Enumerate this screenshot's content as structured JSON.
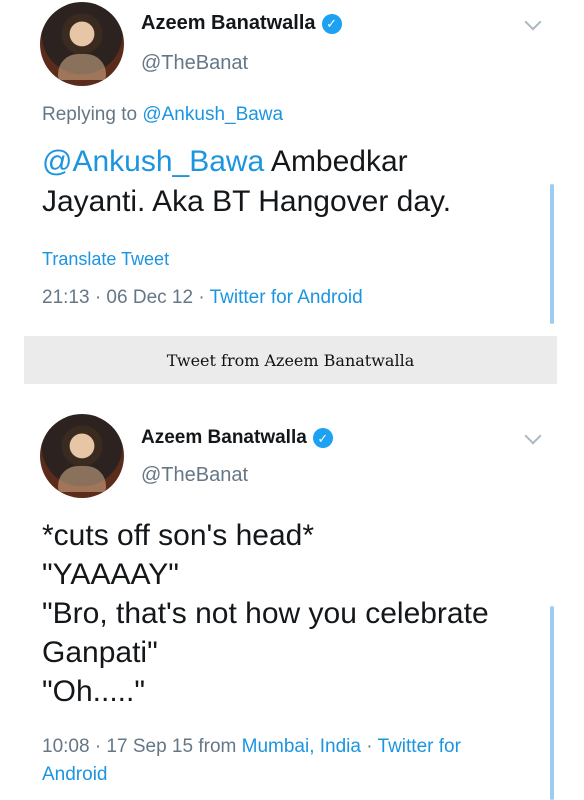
{
  "tweet1": {
    "author_name": "Azeem Banatwalla",
    "verified_glyph": "✓",
    "handle": "@TheBanat",
    "replying_prefix": "Replying to",
    "replying_to": "@Ankush_Bawa",
    "mention": "@Ankush_Bawa",
    "text_line1_rest": " Ambedkar",
    "text_line2": "Jayanti. Aka BT Hangover day.",
    "translate_label": "Translate Tweet",
    "timestamp": "21:13 · 06 Dec 12 · ",
    "source": "Twitter for Android"
  },
  "caption": {
    "text": "Tweet from Azeem Banatwalla"
  },
  "tweet2": {
    "author_name": "Azeem Banatwalla",
    "verified_glyph": "✓",
    "handle": "@TheBanat",
    "lines": [
      "*cuts off son's head*",
      "\"YAAAAY\"",
      "\"Bro, that's not how you celebrate",
      "Ganpati\"",
      "\"Oh.....\""
    ],
    "timestamp": "10:08 · 17 Sep 15 from ",
    "location": "Mumbai, India",
    "separator": " · ",
    "source_line1": "Twitter for",
    "source_line2": "Android"
  },
  "colors": {
    "accent": "#1b95e0",
    "verified": "#1da1f2",
    "muted": "#657786",
    "caption_bg": "#ebebeb"
  },
  "icons": {
    "verified": "verified-badge-icon",
    "more": "chevron-down-icon"
  }
}
